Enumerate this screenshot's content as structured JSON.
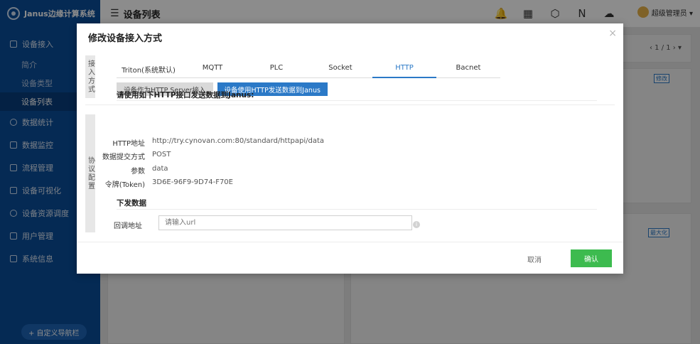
{
  "app": {
    "name": "Janus边缘计算系统"
  },
  "sidebar": {
    "groups": [
      {
        "label": "设备接入",
        "icon": "grid-icon"
      },
      {
        "label": "数据统计",
        "icon": "clock-icon"
      },
      {
        "label": "数据监控",
        "icon": "monitor-icon"
      },
      {
        "label": "流程管理",
        "icon": "flow-icon"
      },
      {
        "label": "设备可视化",
        "icon": "visual-icon"
      },
      {
        "label": "设备资源调度",
        "icon": "schedule-icon"
      },
      {
        "label": "用户管理",
        "icon": "users-icon"
      },
      {
        "label": "系统信息",
        "icon": "settings-icon"
      }
    ],
    "sub_items": [
      "简介",
      "设备类型",
      "设备列表"
    ],
    "custom_nav": "+ 自定义导航栏"
  },
  "header": {
    "title": "设备列表",
    "icons": [
      "bell-icon",
      "apps-icon",
      "api-icon",
      "n-icon",
      "cloud-icon"
    ],
    "user": "超级管理员 ▾"
  },
  "background": {
    "pager": "‹ 1 / 1 › ▾",
    "edit_button": "修改",
    "maximize_button": "最大化"
  },
  "modal": {
    "title": "修改设备接入方式",
    "close": "×",
    "access_section_label": "接入方式",
    "protocol_section_label": "协议配置",
    "tabs": [
      "Triton(系统默认)",
      "MQTT",
      "PLC",
      "Socket",
      "HTTP",
      "Bacnet"
    ],
    "active_tab": "HTTP",
    "modes": [
      "设备作为HTTP Server接入",
      "设备使用HTTP发送数据到Janus"
    ],
    "active_mode": "设备使用HTTP发送数据到Janus",
    "description": "请使用如下HTTP接口发送数据到Janus:",
    "fields": [
      {
        "key": "HTTP地址",
        "value": "http://try.cynovan.com:80/standard/httpapi/data"
      },
      {
        "key": "数据提交方式",
        "value": "POST"
      },
      {
        "key": "参数",
        "value": "data"
      },
      {
        "key": "令牌(Token)",
        "value": "3D6E-96F9-9D74-F70E"
      }
    ],
    "push_title": "下发数据",
    "callback_label": "回调地址",
    "callback_placeholder": "请输入url",
    "callback_value": "",
    "cancel_label": "取消",
    "ok_label": "确认"
  }
}
